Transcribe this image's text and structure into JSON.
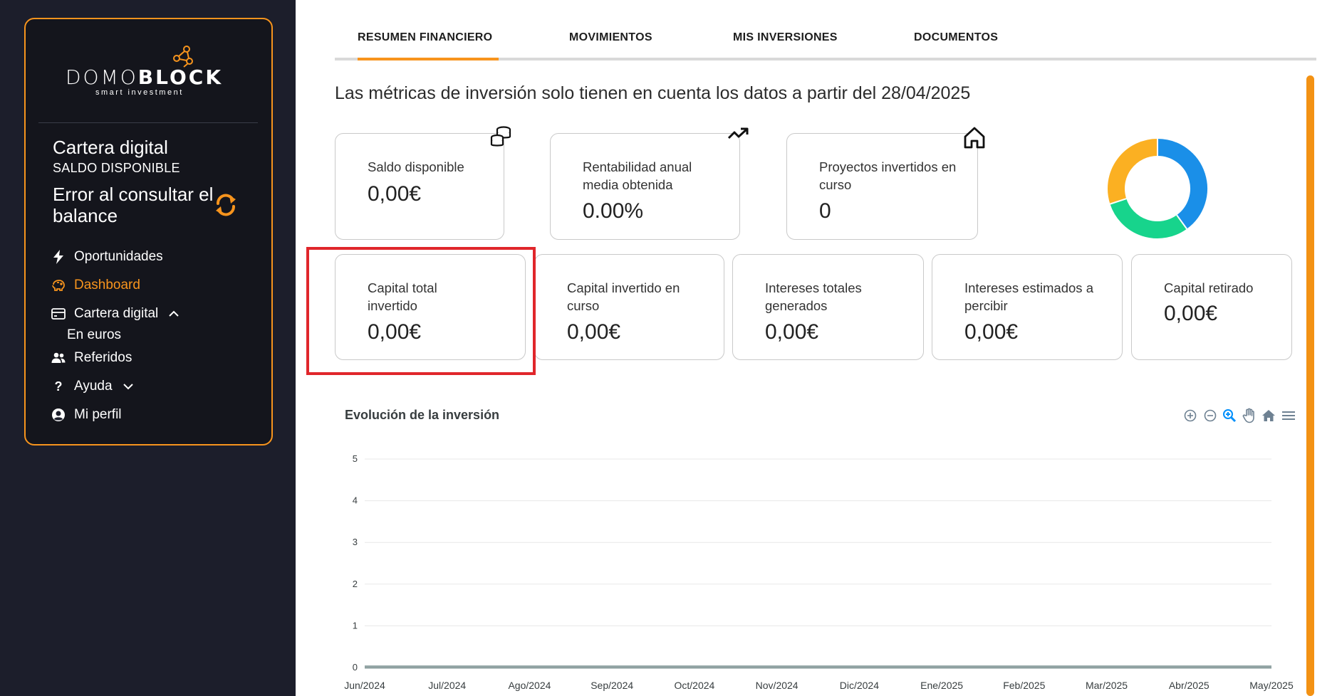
{
  "sidebar": {
    "logo_main_thin": "DOMO",
    "logo_main_bold": "BLOCK",
    "logo_sub": "smart investment",
    "wallet_title": "Cartera digital",
    "wallet_subtitle": "SALDO DISPONIBLE",
    "balance_text": "Error al consultar el balance",
    "nav": {
      "opportunities": {
        "label": "Oportunidades",
        "icon": "bolt-icon"
      },
      "dashboard": {
        "label": "Dashboard",
        "icon": "piggy-bank-icon"
      },
      "wallet": {
        "label": "Cartera digital",
        "icon": "credit-card-icon",
        "sub_label": "En euros"
      },
      "referrals": {
        "label": "Referidos",
        "icon": "users-icon"
      },
      "help": {
        "label": "Ayuda",
        "icon": "question-icon"
      },
      "profile": {
        "label": "Mi perfil",
        "icon": "user-circle-icon"
      }
    },
    "accent_color": "#f7941d"
  },
  "tabs": [
    {
      "label": "RESUMEN FINANCIERO",
      "active": true
    },
    {
      "label": "MOVIMIENTOS",
      "active": false
    },
    {
      "label": "MIS INVERSIONES",
      "active": false
    },
    {
      "label": "DOCUMENTOS",
      "active": false
    }
  ],
  "notice": "Las métricas de inversión solo tienen en cuenta los datos a partir del 28/04/2025",
  "metrics_top": [
    {
      "label": "Saldo disponible",
      "value": "0,00€",
      "icon": "coins-stack-icon"
    },
    {
      "label": "Rentabilidad anual media obtenida",
      "value": "0.00%",
      "icon": "trending-up-icon"
    },
    {
      "label": "Proyectos invertidos en curso",
      "value": "0",
      "icon": "home-icon"
    }
  ],
  "metrics_bottom": [
    {
      "label": "Capital total invertido",
      "value": "0,00€"
    },
    {
      "label": "Capital invertido en curso",
      "value": "0,00€"
    },
    {
      "label": "Intereses totales generados",
      "value": "0,00€"
    },
    {
      "label": "Intereses estimados a percibir",
      "value": "0,00€"
    },
    {
      "label": "Capital retirado",
      "value": "0,00€"
    }
  ],
  "donut": {
    "segments": [
      {
        "fraction": 0.4,
        "color": "#1a8fe8"
      },
      {
        "fraction": 0.3,
        "color": "#17d48c"
      },
      {
        "fraction": 0.3,
        "color": "#fbb022"
      }
    ]
  },
  "chart_data": {
    "type": "area",
    "title": "Evolución de la inversión",
    "categories": [
      "Jun/2024",
      "Jul/2024",
      "Ago/2024",
      "Sep/2024",
      "Oct/2024",
      "Nov/2024",
      "Dic/2024",
      "Ene/2025",
      "Feb/2025",
      "Mar/2025",
      "Abr/2025",
      "May/2025"
    ],
    "series": [
      {
        "values": [
          0,
          0,
          0,
          0,
          0,
          0,
          0,
          0,
          0,
          0,
          0,
          0
        ],
        "color": "#8fa1a1"
      }
    ],
    "yticks": [
      0,
      1,
      2,
      3,
      4,
      5
    ],
    "ylim": [
      0,
      5
    ],
    "grid": true,
    "toolbar": [
      "zoom-in-icon",
      "zoom-out-icon",
      "zoom-selection-icon",
      "pan-hand-icon",
      "reset-home-icon",
      "menu-icon"
    ]
  }
}
